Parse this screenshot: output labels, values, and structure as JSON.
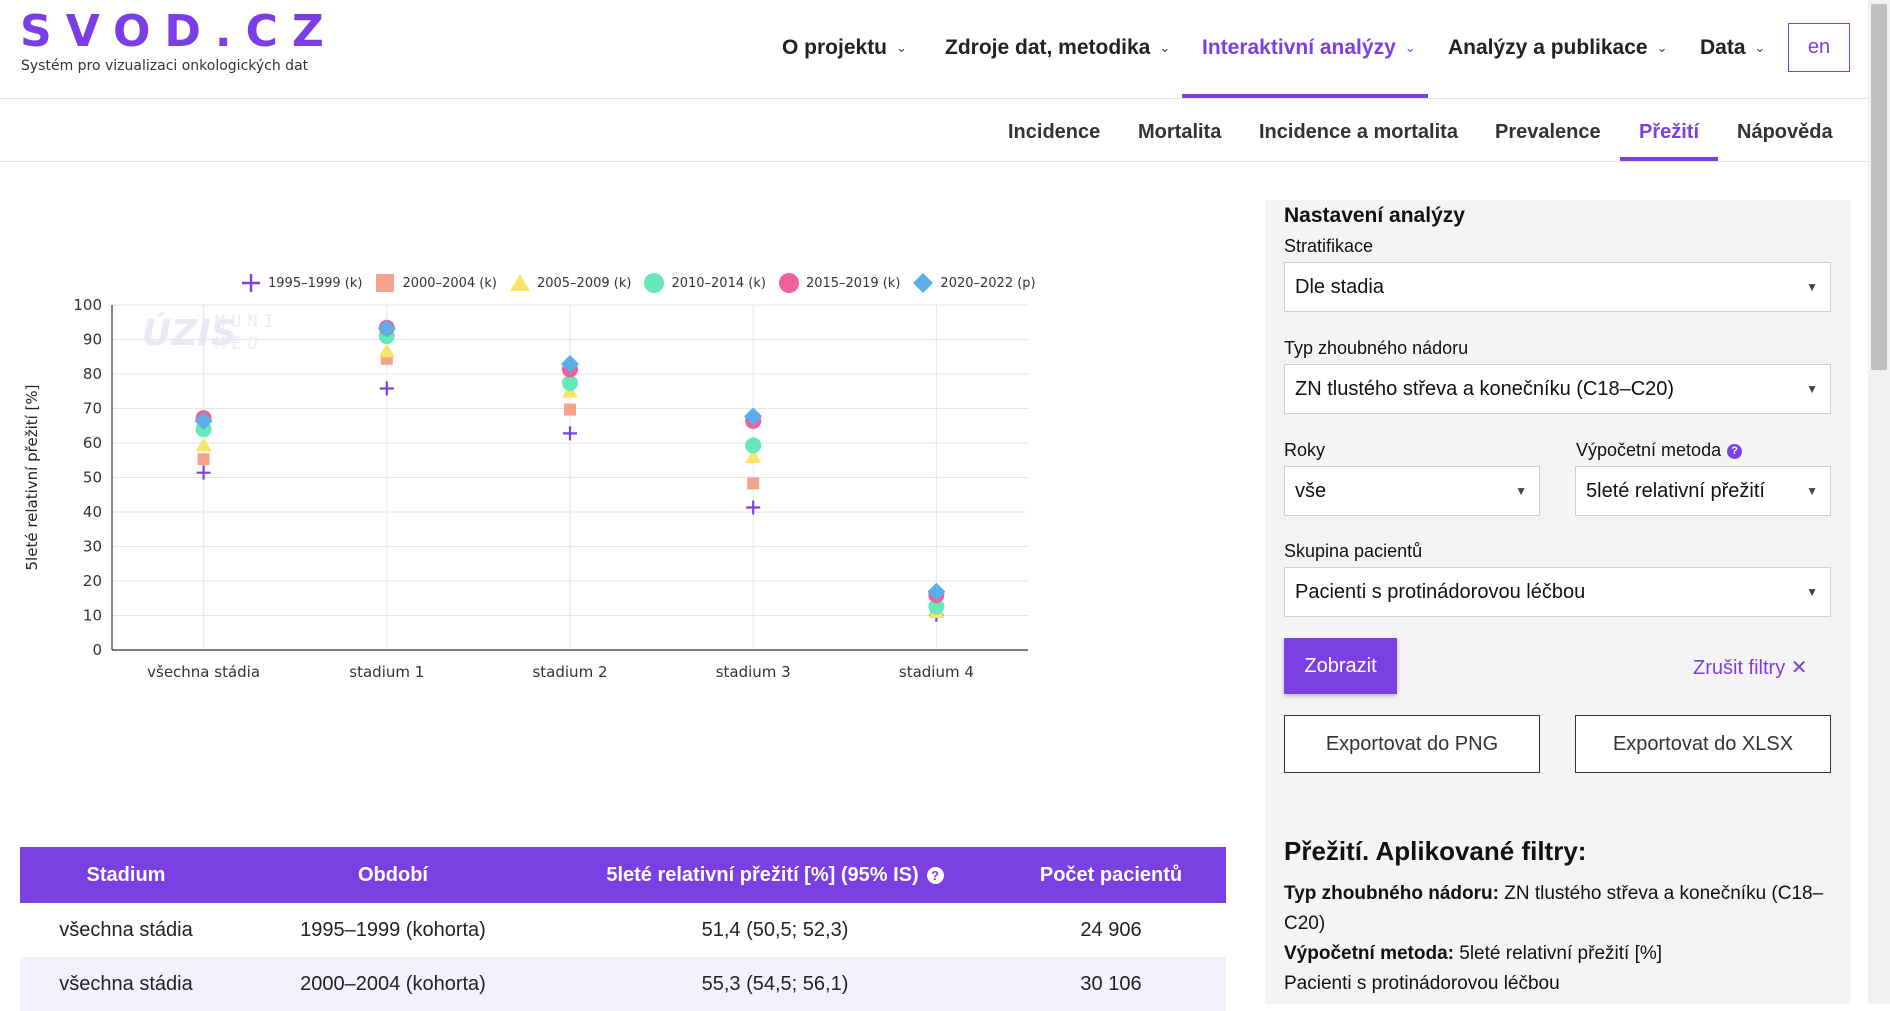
{
  "header": {
    "logo": "SVOD.CZ",
    "tagline": "Systém pro vizualizaci onkologických dat",
    "nav": [
      {
        "label": "O projektu"
      },
      {
        "label": "Zdroje dat, metodika"
      },
      {
        "label": "Interaktivní analýzy",
        "active": true
      },
      {
        "label": "Analýzy a publikace"
      },
      {
        "label": "Data"
      }
    ],
    "lang": "en"
  },
  "subnav": [
    {
      "label": "Incidence"
    },
    {
      "label": "Mortalita"
    },
    {
      "label": "Incidence a mortalita"
    },
    {
      "label": "Prevalence"
    },
    {
      "label": "Přežití",
      "active": true
    },
    {
      "label": "Nápověda"
    }
  ],
  "watermark": {
    "left": "ÚZIS",
    "right_top": "MUNI",
    "right_bottom": "MED"
  },
  "chart_data": {
    "type": "scatter",
    "title": "",
    "xlabel": "",
    "ylabel": "5leté relativní přežití [%]",
    "ylim": [
      0,
      100
    ],
    "yticks": [
      0,
      10,
      20,
      30,
      40,
      50,
      60,
      70,
      80,
      90,
      100
    ],
    "grid": true,
    "legend_position": "top",
    "categories": [
      "všechna stádia",
      "stadium 1",
      "stadium 2",
      "stadium 3",
      "stadium 4"
    ],
    "series": [
      {
        "name": "1995–1999 (k)",
        "marker": "cross",
        "color": "#7b3fe4",
        "values": [
          51.4,
          75.8,
          62.8,
          41.3,
          10.2
        ]
      },
      {
        "name": "2000–2004 (k)",
        "marker": "square",
        "color": "#f5a38c",
        "values": [
          55.3,
          84.4,
          69.7,
          48.3,
          11.2
        ]
      },
      {
        "name": "2005–2009 (k)",
        "marker": "triangle",
        "color": "#f9e46a",
        "values": [
          59.3,
          86.6,
          74.9,
          55.9,
          11.0
        ]
      },
      {
        "name": "2010–2014 (k)",
        "marker": "circle",
        "color": "#66e8b8",
        "values": [
          64.0,
          91.0,
          77.4,
          59.3,
          12.6
        ]
      },
      {
        "name": "2015–2019 (k)",
        "marker": "circle",
        "color": "#f0609a",
        "values": [
          67.2,
          93.4,
          81.3,
          66.4,
          15.9
        ]
      },
      {
        "name": "2020–2022 (p)",
        "marker": "diamond",
        "color": "#5aafe8",
        "values": [
          66.4,
          93.2,
          82.9,
          67.7,
          16.9
        ]
      }
    ]
  },
  "table": {
    "headers": [
      "Stadium",
      "Období",
      "5leté relativní přežití [%] (95% IS)",
      "Počet pacientů"
    ],
    "rows": [
      [
        "všechna stádia",
        "1995–1999 (kohorta)",
        "51,4 (50,5; 52,3)",
        "24 906"
      ],
      [
        "všechna stádia",
        "2000–2004 (kohorta)",
        "55,3 (54,5; 56,1)",
        "30 106"
      ]
    ]
  },
  "panel": {
    "title": "Nastavení analýzy",
    "stratifikace_label": "Stratifikace",
    "stratifikace_value": "Dle stadia",
    "typ_label": "Typ zhoubného nádoru",
    "typ_value": "ZN tlustého střeva a konečníku (C18–C20)",
    "roky_label": "Roky",
    "roky_value": "vše",
    "metoda_label": "Výpočetní metoda",
    "metoda_value": "5leté relativní přežití",
    "skupina_label": "Skupina pacientů",
    "skupina_value": "Pacienti s protinádorovou léčbou",
    "zobrazit": "Zobrazit",
    "zrusit": "Zrušit filtry",
    "export_png": "Exportovat do PNG",
    "export_xlsx": "Exportovat do XLSX"
  },
  "filters": {
    "title": "Přežití. Aplikované filtry:",
    "typ_key": "Typ zhoubného nádoru:",
    "typ_val": "ZN tlustého střeva a konečníku (C18–C20)",
    "metoda_key": "Výpočetní metoda:",
    "metoda_val": "5leté relativní přežití [%]",
    "skupina": "Pacienti s protinádorovou léčbou"
  },
  "colors": {
    "accent": "#7b3fe4",
    "row_alt": "#f4f0fd"
  }
}
